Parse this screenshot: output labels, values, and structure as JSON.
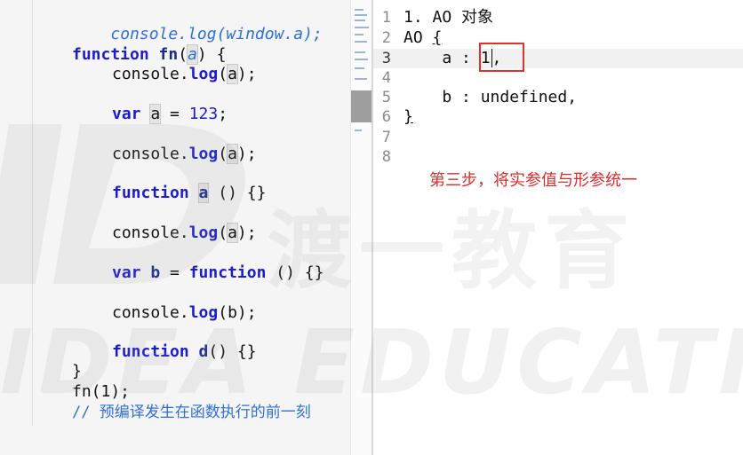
{
  "left_editor": {
    "line_top": "console.log(window.a);",
    "fn_decl": {
      "keyword": "function",
      "name": "fn",
      "param": "a",
      "rest": ") {"
    },
    "log1": {
      "obj": "console.",
      "method": "log",
      "arg": "a",
      "end": ");"
    },
    "var_a": {
      "keyword": "var",
      "name": "a",
      "assign": " = ",
      "value": "123",
      "end": ";"
    },
    "log2": {
      "obj": "console.",
      "method": "log",
      "arg": "a",
      "end": ");"
    },
    "func_a": {
      "keyword": "function",
      "name": "a",
      "rest": " () {}"
    },
    "log3": {
      "obj": "console.",
      "method": "log",
      "arg": "a",
      "end": ");"
    },
    "var_b": {
      "keyword": "var",
      "name": "b",
      "assign": " = ",
      "fkeyword": "function",
      "rest": " () {}"
    },
    "log4": {
      "obj": "console.",
      "method": "log",
      "arg": "b",
      "end": ");"
    },
    "func_d": {
      "keyword": "function",
      "name": "d",
      "rest": "() {}"
    },
    "close_brace": "}",
    "call": "fn(1);",
    "comment": "// 预编译发生在函数执行的前一刻"
  },
  "right_editor": {
    "line_numbers": [
      "1",
      "2",
      "3",
      "4",
      "5",
      "6",
      "7",
      "8"
    ],
    "lines": {
      "l1": "1. AO 对象",
      "l2_text": "AO ",
      "l2_brace": "{",
      "l3_key": "    a : ",
      "l3_value": "1",
      "l3_comma": ",",
      "l5": "    b : undefined,",
      "l6": "}"
    },
    "annotation": "第三步，将实参值与形参统一"
  },
  "watermark": {
    "text_en": "IDEA EDUCATION",
    "text_cn": "渡一教育"
  },
  "colors": {
    "keyword": "#1c1ccc",
    "comment": "#2f6fd6",
    "annotation": "#e02b2b",
    "highlight_box": "#e03030"
  }
}
